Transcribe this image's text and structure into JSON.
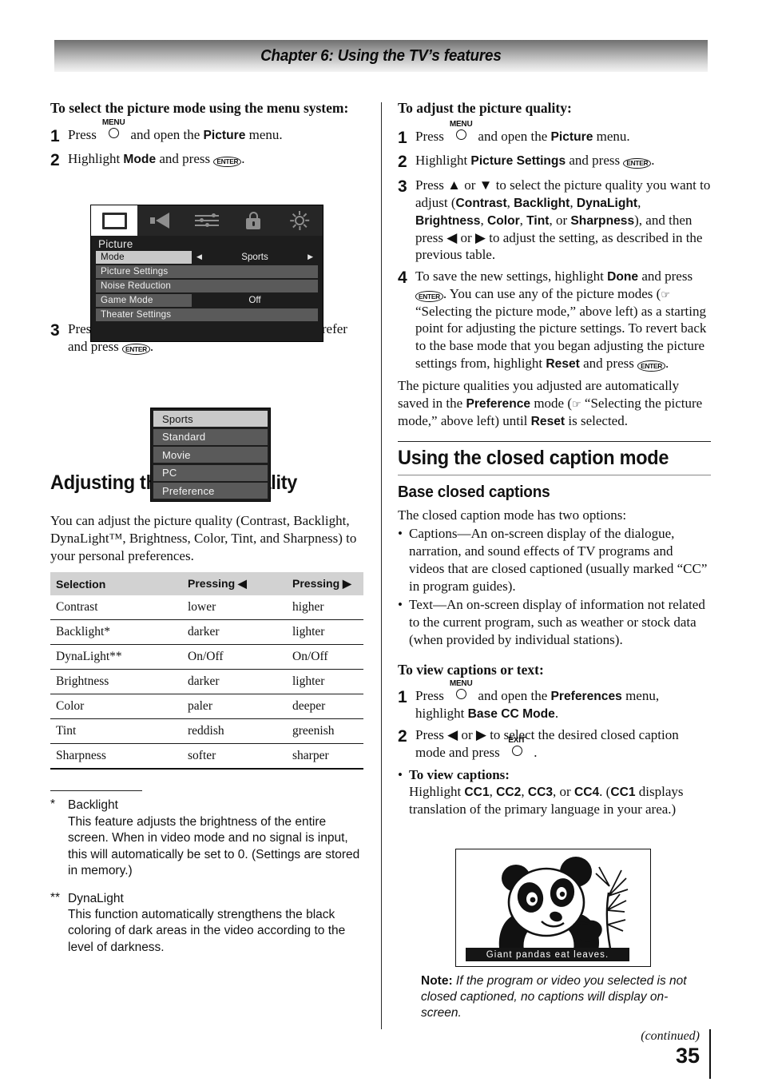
{
  "header": {
    "chapter_title": "Chapter 6: Using the TV’s features"
  },
  "left": {
    "heading": "To select the picture mode using the menu system:",
    "step1": {
      "num": "1",
      "pre": "Press",
      "key": "MENU",
      "post_a": "and open the",
      "bold": "Picture",
      "post_b": "menu."
    },
    "step2": {
      "num": "2",
      "pre": "Highlight",
      "bold": "Mode",
      "post": "and press",
      "key": "ENTER",
      "end": "."
    },
    "step3": {
      "num": "3",
      "text": "Press ▲ or ▼ to select the picture mode you prefer and press",
      "key": "ENTER",
      "end": "."
    },
    "osd": {
      "title": "Picture",
      "icons": [
        "picture-icon",
        "sound-icon",
        "settings-icon",
        "lock-icon",
        "setup-icon"
      ],
      "selected_icon": "picture-icon",
      "rows": [
        {
          "label": "Mode",
          "value": "Sports",
          "highlighted": true,
          "has_arrows": true
        },
        {
          "label": "Picture Settings",
          "value": "",
          "highlighted": false,
          "has_arrows": false
        },
        {
          "label": "Noise Reduction",
          "value": "",
          "highlighted": false,
          "has_arrows": false
        },
        {
          "label": "Game Mode",
          "value": "Off",
          "highlighted": false,
          "has_arrows": false
        },
        {
          "label": "Theater Settings",
          "value": "",
          "highlighted": false,
          "has_arrows": false
        }
      ]
    },
    "mode_list": {
      "items": [
        "Sports",
        "Standard",
        "Movie",
        "PC",
        "Preference"
      ],
      "selected": "Sports"
    },
    "adjust_heading": "Adjusting the picture quality",
    "adjust_para": "You can adjust the picture quality (Contrast, Backlight, DynaLight™, Brightness, Color, Tint, and Sharpness) to your personal preferences.",
    "table": {
      "headers": [
        "Selection",
        "Pressing ◀",
        "Pressing ▶"
      ],
      "rows": [
        [
          "Contrast",
          "lower",
          "higher"
        ],
        [
          "Backlight*",
          "darker",
          "lighter"
        ],
        [
          "DynaLight**",
          "On/Off",
          "On/Off"
        ],
        [
          "Brightness",
          "darker",
          "lighter"
        ],
        [
          "Color",
          "paler",
          "deeper"
        ],
        [
          "Tint",
          "reddish",
          "greenish"
        ],
        [
          "Sharpness",
          "softer",
          "sharper"
        ]
      ]
    },
    "footnotes": [
      {
        "mark": "*",
        "title": "Backlight",
        "text": "This feature adjusts the brightness of the entire screen. When in video mode and no signal is input, this will automatically be set to 0. (Settings are stored in memory.)"
      },
      {
        "mark": "**",
        "title": "DynaLight",
        "text": "This function automatically strengthens the black coloring of dark areas in the video according to the level of darkness."
      }
    ]
  },
  "right": {
    "heading": "To adjust the picture quality:",
    "step1": {
      "num": "1",
      "pre": "Press",
      "key": "MENU",
      "post_a": "and open the",
      "bold": "Picture",
      "post_b": "menu."
    },
    "step2": {
      "num": "2",
      "pre": "Highlight",
      "bold": "Picture Settings",
      "post": "and press",
      "key": "ENTER",
      "end": "."
    },
    "step3": {
      "num": "3",
      "a": "Press ▲ or ▼ to select the picture quality you want to adjust (",
      "items": [
        "Contrast",
        "Backlight",
        "DynaLight",
        "Brightness",
        "Color",
        "Tint",
        "Sharpness"
      ],
      "b": "), and then press ◀ or ▶ to adjust the setting, as described in the previous table."
    },
    "step4": {
      "num": "4",
      "a": "To save the new settings, highlight",
      "done": "Done",
      "b": "and press",
      "key": "ENTER",
      "c": ". You can use any of the picture modes (",
      "ref": "“Selecting the picture mode,” above left",
      "d": ") as a starting point for adjusting the picture settings. To revert back to the base mode that you began adjusting the picture settings from, highlight",
      "reset": "Reset",
      "e": "and press",
      "key2": "ENTER",
      "f": "."
    },
    "para": {
      "a": "The picture qualities you adjusted are automatically saved in the",
      "pref": "Preference",
      "b": "mode (",
      "ref": "“Selecting the picture mode,” above left",
      "c": ") until",
      "reset": "Reset",
      "d": "is selected."
    },
    "cc_heading": "Using the closed caption mode",
    "base_heading": "Base closed captions",
    "base_intro": "The closed caption mode has two options:",
    "bullets": [
      "Captions—An on-screen display of the dialogue, narration, and sound effects of TV programs and videos that are closed captioned (usually marked “CC” in program guides).",
      "Text—An on-screen display of information not related to the current program, such as weather or stock data (when provided by individual stations)."
    ],
    "view_heading": "To view captions or text:",
    "view_step1": {
      "num": "1",
      "pre": "Press",
      "key": "MENU",
      "post_a": "and open the",
      "bold": "Preferences",
      "post_b": "menu, highlight",
      "bold2": "Base CC Mode",
      "end": "."
    },
    "view_step2": {
      "num": "2",
      "a": "Press ◀ or ▶ to select the desired closed caption mode and press",
      "key": "EXIT",
      "end": "."
    },
    "view_bullet": {
      "title": "To view captions:",
      "a": "Highlight",
      "codes": [
        "CC1",
        "CC2",
        "CC3",
        "CC4"
      ],
      "b": ". (",
      "code_first": "CC1",
      "c": "displays translation of the primary language in your area.)"
    },
    "figure_caption": "Giant  pandas  eat  leaves.",
    "note": {
      "label": "Note:",
      "text": "If the program or video you selected is not closed captioned, no captions will display on-screen."
    }
  },
  "footer": {
    "continued": "(continued)",
    "page_number": "35"
  },
  "colors": {
    "osd_bg": "#1d1d1d",
    "osd_row": "#5a5a5a",
    "osd_row_highlight": "#c9c9c9",
    "table_header": "#d2d2d2"
  }
}
